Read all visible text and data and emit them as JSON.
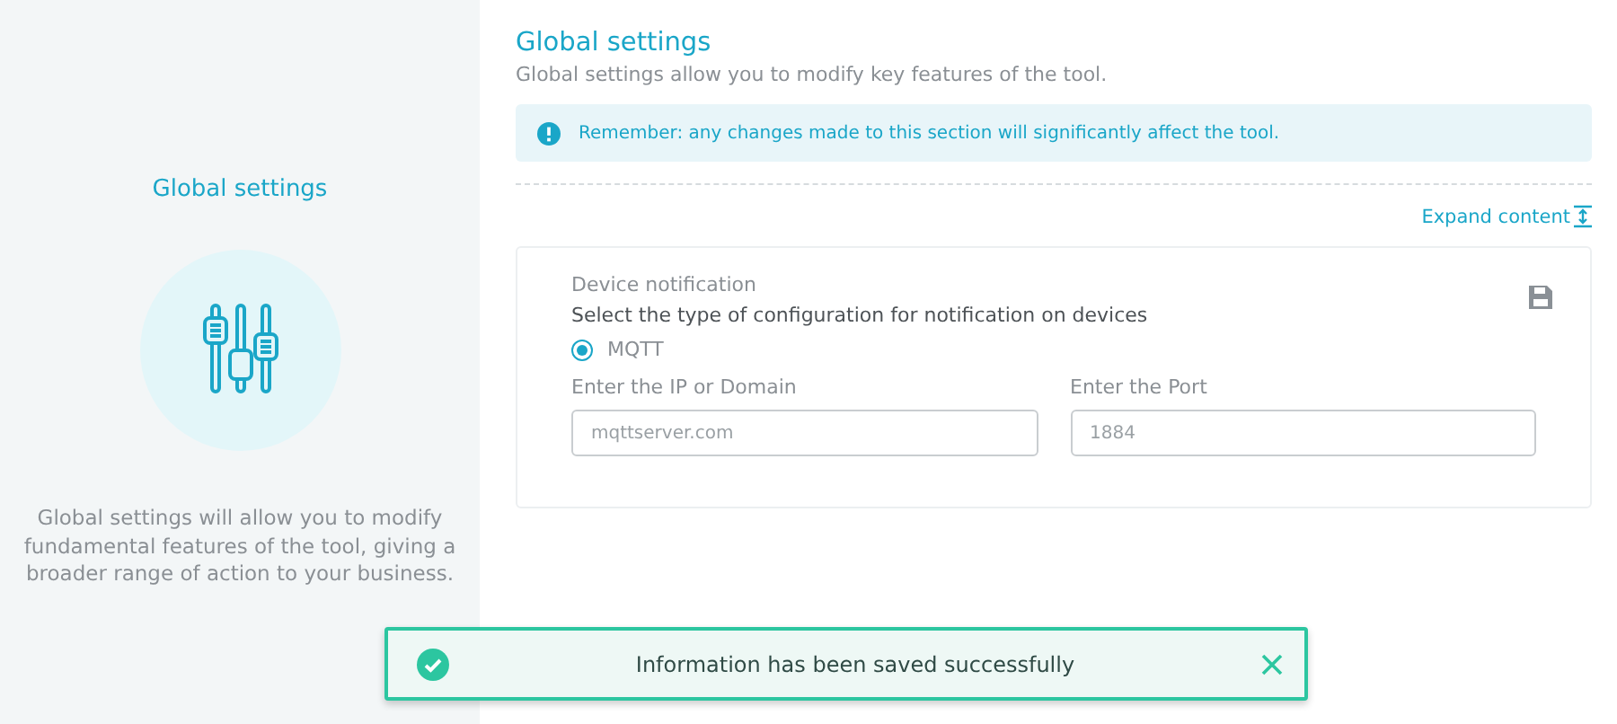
{
  "sidebar": {
    "title": "Global settings",
    "description": "Global settings will allow you to modify fundamental features of the tool, giving a broader range of action to your business."
  },
  "header": {
    "title": "Global settings",
    "subtitle": "Global settings allow you to modify key features of the tool."
  },
  "alert": {
    "text": "Remember: any changes made to this section will significantly affect the tool."
  },
  "expand_link": "Expand content",
  "card": {
    "title": "Device notification",
    "description": "Select the type of configuration for notification on devices",
    "options": [
      {
        "label": "MQTT",
        "selected": true
      }
    ],
    "fields": [
      {
        "label": "Enter the IP or Domain",
        "placeholder": "mqttserver.com"
      },
      {
        "label": "Enter the Port",
        "placeholder": "1884"
      }
    ]
  },
  "toast": {
    "message": "Information has been saved successfully"
  }
}
